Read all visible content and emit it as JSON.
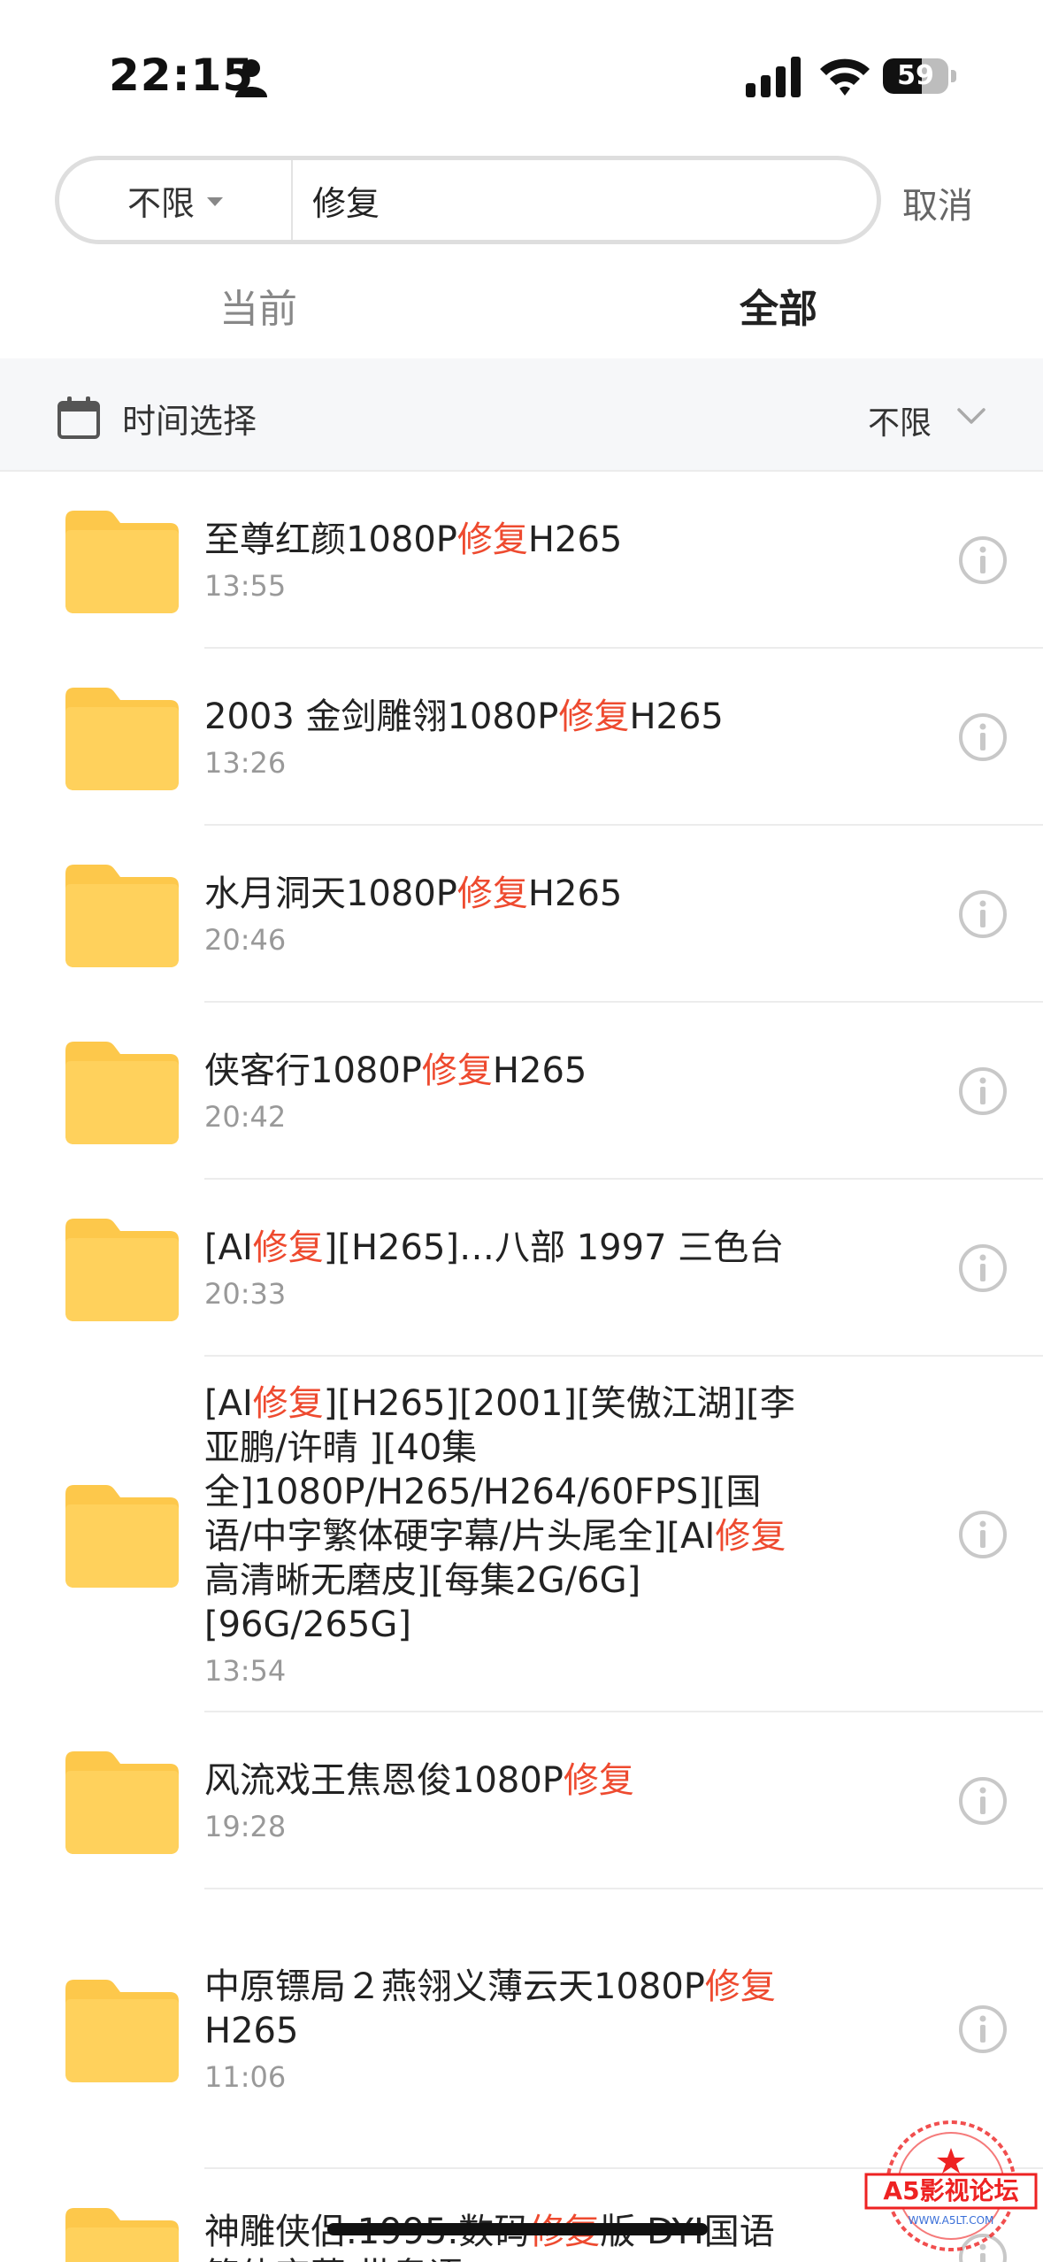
{
  "status_bar": {
    "time": "22:15",
    "battery": "59",
    "battery_level": 0.59
  },
  "search": {
    "scope": "不限",
    "query": "修复",
    "cancel": "取消"
  },
  "tabs": [
    {
      "label": "当前"
    },
    {
      "label": "全部"
    }
  ],
  "filter": {
    "label": "时间选择",
    "value": "不限"
  },
  "files": [
    {
      "parts": [
        {
          "text": "至尊红颜1080P",
          "hl": false
        },
        {
          "text": "修复",
          "hl": true
        },
        {
          "text": "H265",
          "hl": false
        }
      ],
      "time": "13:55"
    },
    {
      "parts": [
        {
          "text": "2003 金剑雕翎1080P",
          "hl": false
        },
        {
          "text": "修复",
          "hl": true
        },
        {
          "text": "H265",
          "hl": false
        }
      ],
      "time": "13:26"
    },
    {
      "parts": [
        {
          "text": "水月洞天1080P",
          "hl": false
        },
        {
          "text": "修复",
          "hl": true
        },
        {
          "text": "H265",
          "hl": false
        }
      ],
      "time": "20:46"
    },
    {
      "parts": [
        {
          "text": "侠客行1080P",
          "hl": false
        },
        {
          "text": "修复",
          "hl": true
        },
        {
          "text": "H265",
          "hl": false
        }
      ],
      "time": "20:42"
    },
    {
      "parts": [
        {
          "text": "[AI",
          "hl": false
        },
        {
          "text": "修复",
          "hl": true
        },
        {
          "text": "][H265]…八部 1997 三色台",
          "hl": false
        }
      ],
      "time": "20:33"
    },
    {
      "parts": [
        {
          "text": "[AI",
          "hl": false
        },
        {
          "text": "修复",
          "hl": true
        },
        {
          "text": "][H265][2001][笑傲江湖][李亚鹏/许晴 ][40集全]1080P/H265/H264/60FPS][国语/中字繁体硬字幕/片头尾全][AI",
          "hl": false
        },
        {
          "text": "修复",
          "hl": true
        },
        {
          "text": "高清晰无磨皮][每集2G/6G][96G/265G]",
          "hl": false
        }
      ],
      "time": "13:54"
    },
    {
      "parts": [
        {
          "text": "风流戏王焦恩俊1080P",
          "hl": false
        },
        {
          "text": "修复",
          "hl": true
        }
      ],
      "time": "19:28"
    },
    {
      "parts": [
        {
          "text": "中原镖局２燕翎义薄云天1080P",
          "hl": false
        },
        {
          "text": "修复",
          "hl": true
        },
        {
          "text": "H265",
          "hl": false
        }
      ],
      "time": "11:06"
    },
    {
      "parts": [
        {
          "text": "神雕侠侣.1995.数码",
          "hl": false
        },
        {
          "text": "修复",
          "hl": true
        },
        {
          "text": "版 DYI国语简体字幕 带粤语",
          "hl": false
        }
      ],
      "time": ""
    }
  ],
  "watermark": {
    "line1": "A5影视论坛",
    "line2": "WWW.A5LT.COM"
  },
  "colors": {
    "folder": "#fdc84b",
    "highlight": "#ee4a2f",
    "filter_bg": "#f6f7f9"
  }
}
